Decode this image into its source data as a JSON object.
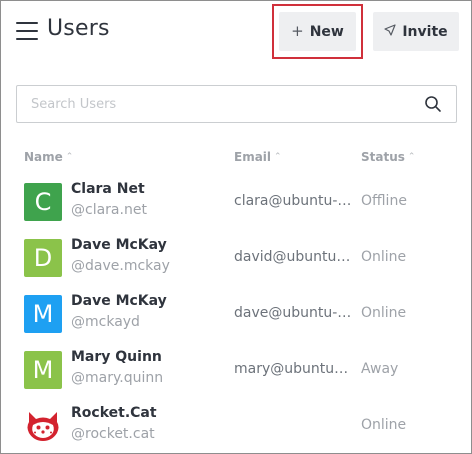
{
  "header": {
    "title": "Users",
    "new_label": "New",
    "invite_label": "Invite"
  },
  "search": {
    "placeholder": "Search Users",
    "value": ""
  },
  "table": {
    "columns": [
      {
        "label": "Name"
      },
      {
        "label": "Email"
      },
      {
        "label": "Status"
      }
    ],
    "rows": [
      {
        "name": "Clara Net",
        "username": "@clara.net",
        "email": "clara@ubuntu-server",
        "status": "Offline",
        "avatar_letter": "C",
        "avatar_color": "#3fa34d"
      },
      {
        "name": "Dave McKay",
        "username": "@dave.mckay",
        "email": "david@ubuntu-server",
        "status": "Online",
        "avatar_letter": "D",
        "avatar_color": "#8bc34a"
      },
      {
        "name": "Dave McKay",
        "username": "@mckayd",
        "email": "dave@ubuntu-server",
        "status": "Online",
        "avatar_letter": "M",
        "avatar_color": "#1ea0f2"
      },
      {
        "name": "Mary Quinn",
        "username": "@mary.quinn",
        "email": "mary@ubuntu-server",
        "status": "Away",
        "avatar_letter": "M",
        "avatar_color": "#8bc34a"
      },
      {
        "name": "Rocket.Cat",
        "username": "@rocket.cat",
        "email": "",
        "status": "Online",
        "avatar_letter": "",
        "avatar_color": "#d3232f",
        "avatar_icon": "rocket-cat-icon"
      }
    ]
  },
  "colors": {
    "highlight": "#d0303b",
    "button_bg": "#eeeff1",
    "text_primary": "#2f343d",
    "text_muted": "#9ea2a8"
  }
}
